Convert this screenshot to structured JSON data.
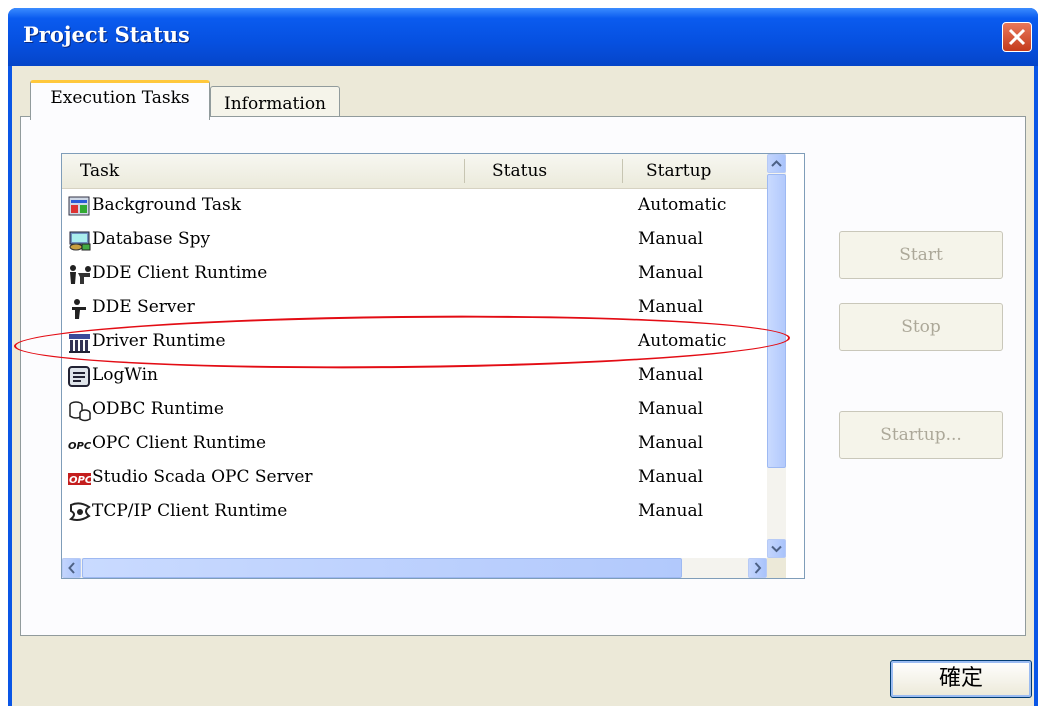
{
  "window": {
    "title": "Project Status",
    "close_icon": "close-icon"
  },
  "tabs": [
    {
      "label": "Execution Tasks",
      "active": true
    },
    {
      "label": "Information",
      "active": false
    }
  ],
  "list": {
    "columns": [
      "Task",
      "Status",
      "Startup"
    ],
    "rows": [
      {
        "icon": "background-task-icon",
        "task": "Background Task",
        "status": "",
        "startup": "Automatic"
      },
      {
        "icon": "database-spy-icon",
        "task": "Database Spy",
        "status": "",
        "startup": "Manual"
      },
      {
        "icon": "dde-client-icon",
        "task": "DDE Client Runtime",
        "status": "",
        "startup": "Manual"
      },
      {
        "icon": "dde-server-icon",
        "task": "DDE Server",
        "status": "",
        "startup": "Manual"
      },
      {
        "icon": "driver-runtime-icon",
        "task": "Driver Runtime",
        "status": "",
        "startup": "Automatic"
      },
      {
        "icon": "logwin-icon",
        "task": "LogWin",
        "status": "",
        "startup": "Manual"
      },
      {
        "icon": "odbc-icon",
        "task": "ODBC Runtime",
        "status": "",
        "startup": "Manual"
      },
      {
        "icon": "opc-client-icon",
        "task": "OPC Client Runtime",
        "status": "",
        "startup": "Manual"
      },
      {
        "icon": "opc-server-icon",
        "task": "Studio Scada OPC Server",
        "status": "",
        "startup": "Manual"
      },
      {
        "icon": "tcpip-client-icon",
        "task": "TCP/IP Client Runtime",
        "status": "",
        "startup": "Manual"
      }
    ]
  },
  "buttons": {
    "start": "Start",
    "stop": "Stop",
    "startup": "Startup...",
    "ok": "確定"
  },
  "colors": {
    "titlebar": "#0a56e6",
    "highlight": "#e30c14",
    "panel": "#ece9d8"
  }
}
